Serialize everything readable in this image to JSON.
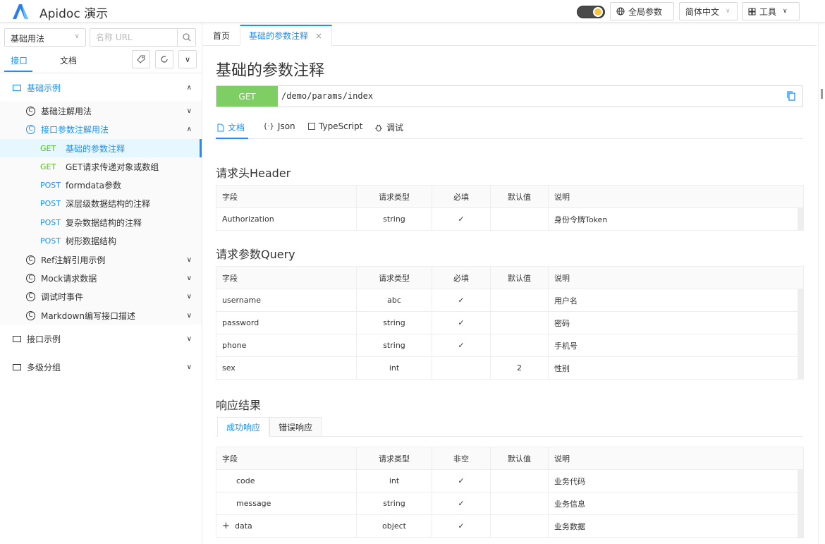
{
  "header": {
    "app_title": "Apidoc 演示",
    "global_params": "全局参数",
    "language": "简体中文",
    "tools": "工具",
    "accent": "#1890ff"
  },
  "sidebar": {
    "group_select": "基础用法",
    "search_placeholder": "名称 URL",
    "tabs": [
      "接口",
      "文档"
    ],
    "active_tab": "接口",
    "tree": {
      "group1": "基础示例",
      "sub1": "基础注解用法",
      "sub2": "接口参数注解用法",
      "apis": [
        {
          "method": "GET",
          "label": "基础的参数注释"
        },
        {
          "method": "GET",
          "label": "GET请求传递对象或数组"
        },
        {
          "method": "POST",
          "label": "formdata参数"
        },
        {
          "method": "POST",
          "label": "深层级数据结构的注释"
        },
        {
          "method": "POST",
          "label": "复杂数据结构的注释"
        },
        {
          "method": "POST",
          "label": "树形数据结构"
        }
      ],
      "sub3": "Ref注解引用示例",
      "sub4": "Mock请求数据",
      "sub5": "调试时事件",
      "sub6": "Markdown编写接口描述",
      "group2": "接口示例",
      "group3": "多级分组"
    }
  },
  "page_tabs": {
    "home": "首页",
    "current": "基础的参数注释"
  },
  "page": {
    "title": "基础的参数注释",
    "method": "GET",
    "url": "/demo/params/index",
    "doc_tabs": [
      "文档",
      "Json",
      "TypeScript",
      "调试"
    ]
  },
  "header_section": {
    "title": "请求头Header",
    "cols": [
      "字段",
      "请求类型",
      "必填",
      "默认值",
      "说明"
    ],
    "rows": [
      [
        "Authorization",
        "string",
        "✓",
        "",
        "身份令牌Token"
      ]
    ]
  },
  "query_section": {
    "title": "请求参数Query",
    "cols": [
      "字段",
      "请求类型",
      "必填",
      "默认值",
      "说明"
    ],
    "rows": [
      [
        "username",
        "abc",
        "✓",
        "",
        "用户名"
      ],
      [
        "password",
        "string",
        "✓",
        "",
        "密码"
      ],
      [
        "phone",
        "string",
        "✓",
        "",
        "手机号"
      ],
      [
        "sex",
        "int",
        "",
        "2",
        "性别"
      ]
    ]
  },
  "response_section": {
    "title": "响应结果",
    "tabs": [
      "成功响应",
      "错误响应"
    ],
    "cols": [
      "字段",
      "请求类型",
      "非空",
      "默认值",
      "说明"
    ],
    "rows": [
      [
        "code",
        "int",
        "✓",
        "",
        "业务代码"
      ],
      [
        "message",
        "string",
        "✓",
        "",
        "业务信息"
      ],
      [
        "data",
        "object",
        "✓",
        "",
        "业务数据"
      ]
    ],
    "expand": "+"
  }
}
